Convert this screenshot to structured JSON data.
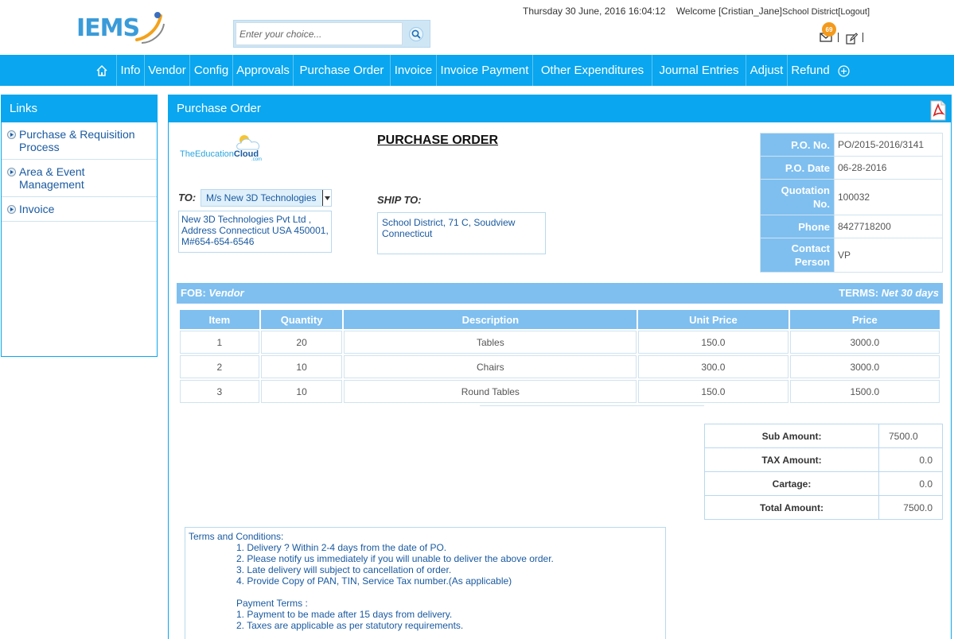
{
  "header": {
    "logo_text": "IEMS",
    "search_placeholder": "Enter your choice...",
    "datetime": "Thursday 30 June, 2016 16:04:12",
    "welcome": "Welcome [Cristian_Jane]",
    "org": "School District",
    "logout": "[Logout]",
    "notification_count": "69"
  },
  "nav": {
    "items": [
      "Info",
      "Vendor",
      "Config",
      "Approvals",
      "Purchase Order",
      "Invoice",
      "Invoice Payment",
      "Other Expenditures",
      "Journal Entries",
      "Adjust",
      "Refund"
    ]
  },
  "sidebar": {
    "title": "Links",
    "items": [
      "Purchase & Requisition Process",
      "Area & Event Management",
      "Invoice"
    ]
  },
  "panel": {
    "title": "Purchase Order",
    "company_logo_a": "The",
    "company_logo_b": "Education",
    "company_logo_c": "Cloud",
    "company_logo_com": ".com",
    "po_heading": "PURCHASE ORDER",
    "to_label": "TO:",
    "vendor_selected": "M/s New 3D Technologies",
    "vendor_address": "New 3D Technologies Pvt Ltd , Address Connecticut USA 450001, M#654-654-6546",
    "ship_to_label": "SHIP TO:",
    "ship_to_address": "School District, 71 C, Soudview Connecticut",
    "po_info": [
      {
        "label": "P.O. No.",
        "value": "PO/2015-2016/3141"
      },
      {
        "label": "P.O. Date",
        "value": "06-28-2016"
      },
      {
        "label": "Quotation No.",
        "value": "100032"
      },
      {
        "label": "Phone",
        "value": "8427718200"
      },
      {
        "label": "Contact Person",
        "value": "VP"
      }
    ],
    "fob_label": "FOB:",
    "fob_value": "Vendor",
    "terms_label": "TERMS:",
    "terms_value": "Net 30 days",
    "table": {
      "headers": [
        "Item",
        "Quantity",
        "Description",
        "Unit Price",
        "Price"
      ],
      "rows": [
        [
          "1",
          "20",
          "Tables",
          "150.0",
          "3000.0"
        ],
        [
          "2",
          "10",
          "Chairs",
          "300.0",
          "3000.0"
        ],
        [
          "3",
          "10",
          "Round Tables",
          "150.0",
          "1500.0"
        ]
      ]
    },
    "totals": [
      {
        "label": "Sub Amount:",
        "value": "7500.0"
      },
      {
        "label": "TAX Amount:",
        "value": "0.0"
      },
      {
        "label": "Cartage:",
        "value": "0.0"
      },
      {
        "label": "Total Amount:",
        "value": "7500.0"
      }
    ],
    "terms_title": "Terms and Conditions:",
    "terms_items": [
      "1. Delivery ? Within 2-4 days from the date of PO.",
      "2. Please notify us immediately if you will unable to deliver the above order.",
      "3. Late delivery will subject to cancellation of order.",
      "4. Provide Copy of PAN, TIN, Service Tax number.(As applicable)"
    ],
    "payment_title": "Payment Terms :",
    "payment_items": [
      "1. Payment to be made after 15 days from delivery.",
      "2. Taxes are applicable as per statutory requirements."
    ]
  },
  "colors": {
    "accent": "#0aa6ef",
    "table_header": "#7fbff0",
    "link_text": "#1a5aa0",
    "badge": "#f39a1c"
  },
  "icons": [
    "home-icon",
    "plus-circle-icon",
    "search-icon",
    "mail-icon",
    "edit-icon",
    "pdf-icon",
    "bullet-icon",
    "dropdown-arrow-icon",
    "cloud-icon"
  ]
}
